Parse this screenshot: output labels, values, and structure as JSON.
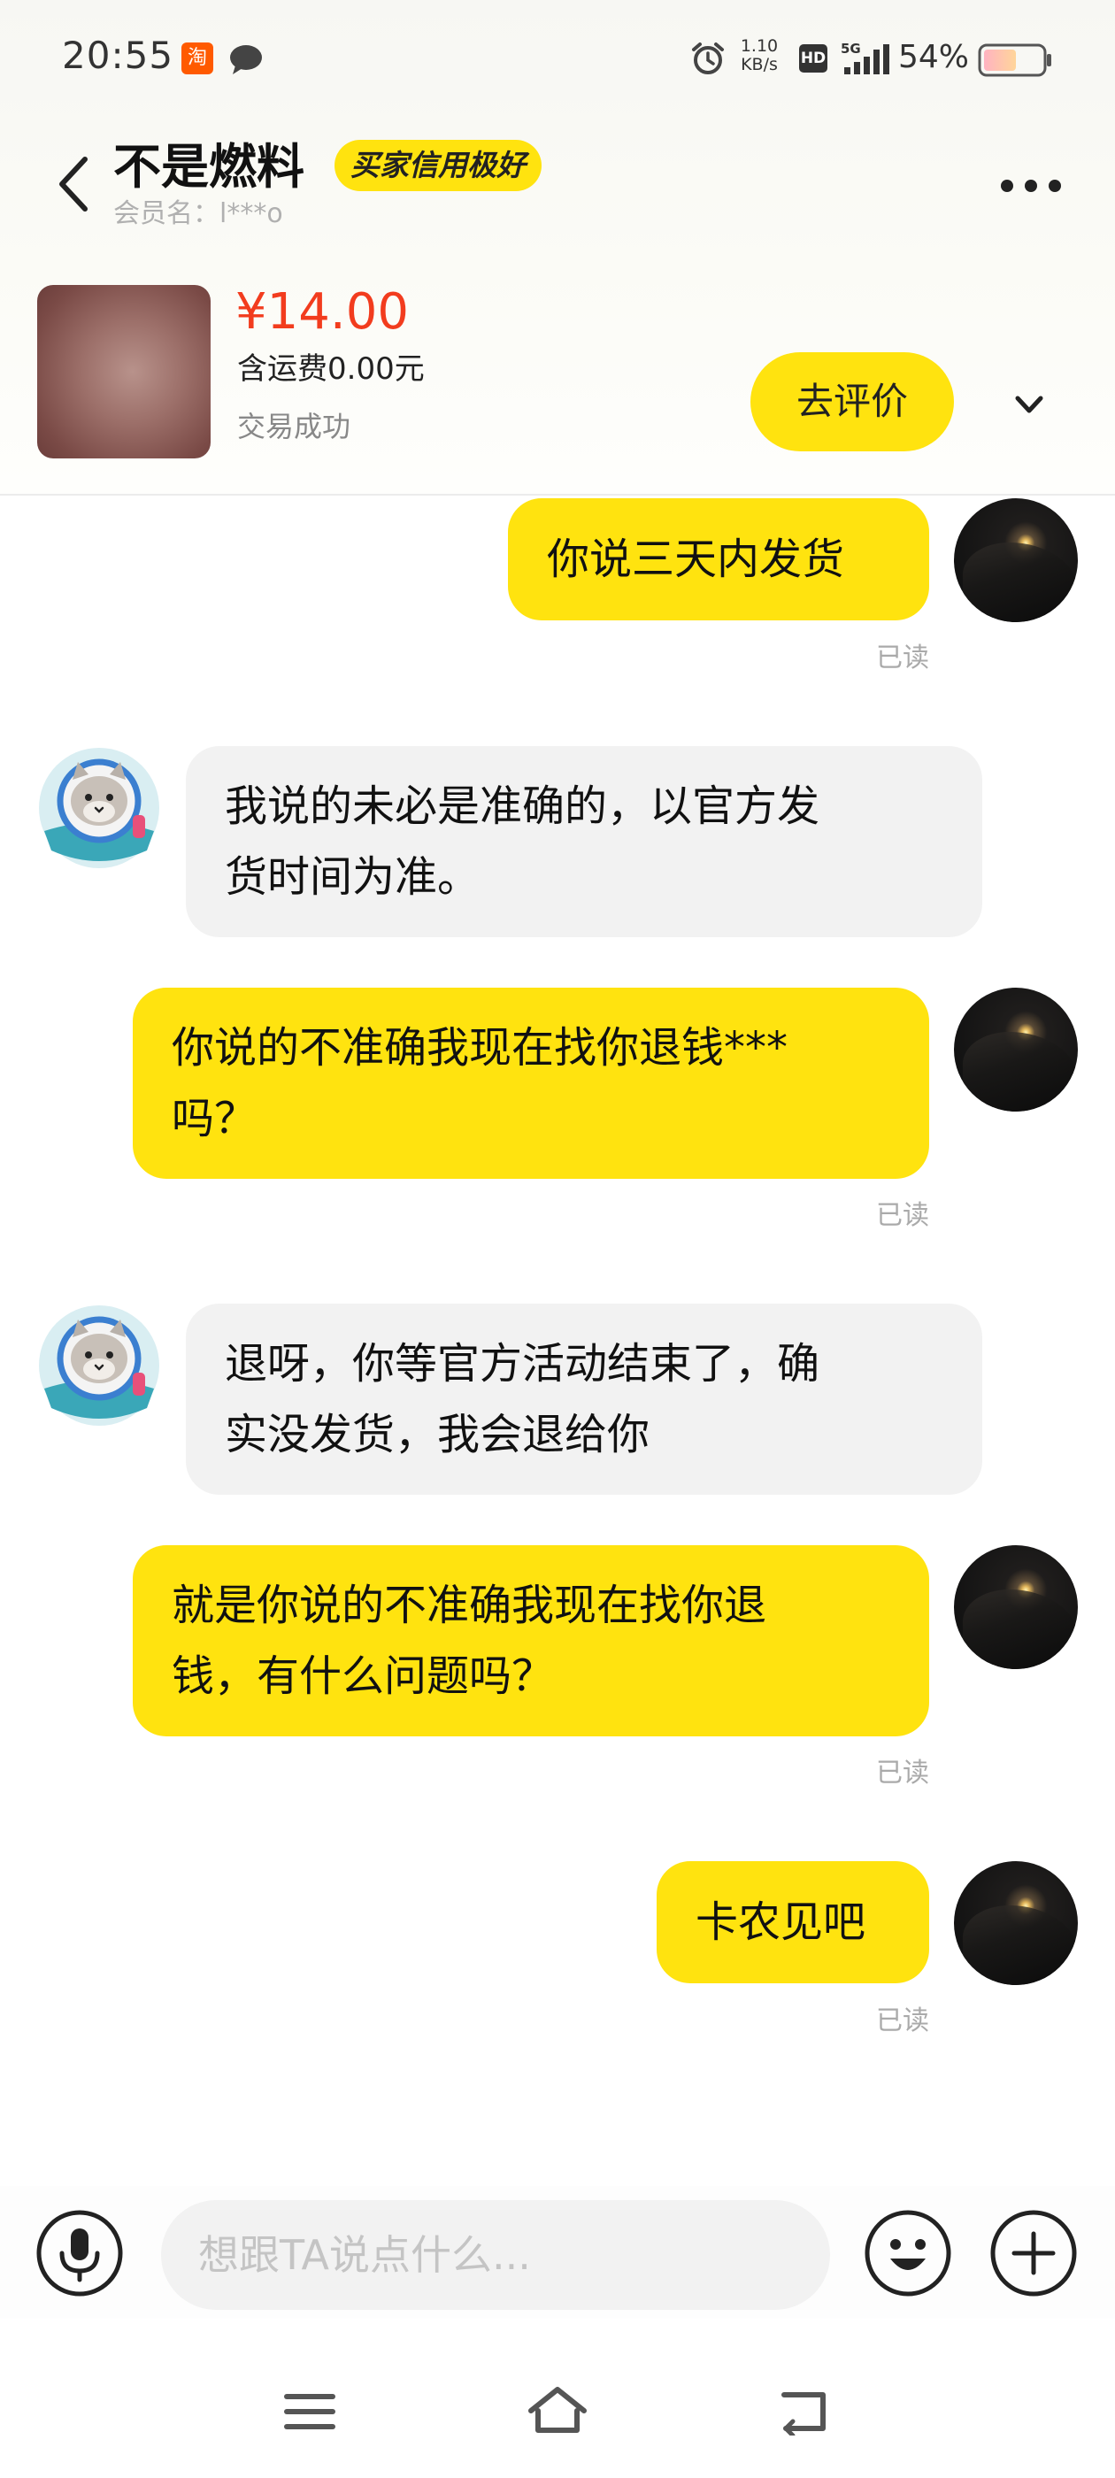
{
  "status_bar": {
    "time": "20:55",
    "taobao_badge": "淘",
    "net_speed_value": "1.10",
    "net_speed_unit": "KB/s",
    "hd_label": "HD",
    "network_type": "5G",
    "battery": "54%"
  },
  "header": {
    "contact_name": "不是燃料",
    "credit_badge": "买家信用极好",
    "member_name": "会员名：l***o"
  },
  "product": {
    "price": "¥14.00",
    "shipping": "含运费0.00元",
    "status": "交易成功",
    "review_button": "去评价"
  },
  "messages": [
    {
      "id": 1,
      "sender": "self",
      "text": "你说三天内发货",
      "read_status": "已读"
    },
    {
      "id": 2,
      "sender": "other",
      "text": "我说的未必是准确的，以官方发\n货时间为准。"
    },
    {
      "id": 3,
      "sender": "self",
      "text": "你说的不准确我现在找你退钱***\n吗？",
      "read_status": "已读"
    },
    {
      "id": 4,
      "sender": "other",
      "text": "退呀，你等官方活动结束了，确\n实没发货，我会退给你"
    },
    {
      "id": 5,
      "sender": "self",
      "text": "就是你说的不准确我现在找你退\n钱，有什么问题吗？",
      "read_status": "已读"
    },
    {
      "id": 6,
      "sender": "self",
      "text": "卡农见吧",
      "read_status": "已读"
    }
  ],
  "input": {
    "placeholder": "想跟TA说点什么..."
  },
  "colors": {
    "accent_yellow": "#ffe30f",
    "price_red": "#f23c1e",
    "received_bubble": "#f2f2f2",
    "muted_text": "#aaaaaa"
  },
  "icons": {
    "back": "chevron-left-icon",
    "more": "more-horizontal-icon",
    "expand": "chevron-down-icon",
    "voice": "microphone-icon",
    "emoji": "smiley-icon",
    "plus": "plus-icon",
    "nav_menu": "menu-icon",
    "nav_home": "home-icon",
    "nav_back": "back-icon"
  }
}
